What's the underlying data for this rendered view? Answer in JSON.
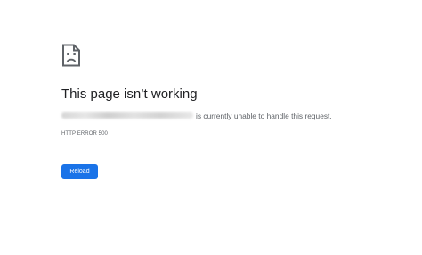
{
  "page": {
    "icon": "sad-page-icon",
    "title": "This page isn’t working",
    "host_blurred": "",
    "message": "is currently unable to handle this request.",
    "error_code": "HTTP ERROR 500",
    "reload_label": "Reload"
  },
  "colors": {
    "background": "#ffffff",
    "title_text": "#202124",
    "secondary_text": "#5f6368",
    "button": "#1a73e8",
    "button_text": "#ffffff"
  }
}
